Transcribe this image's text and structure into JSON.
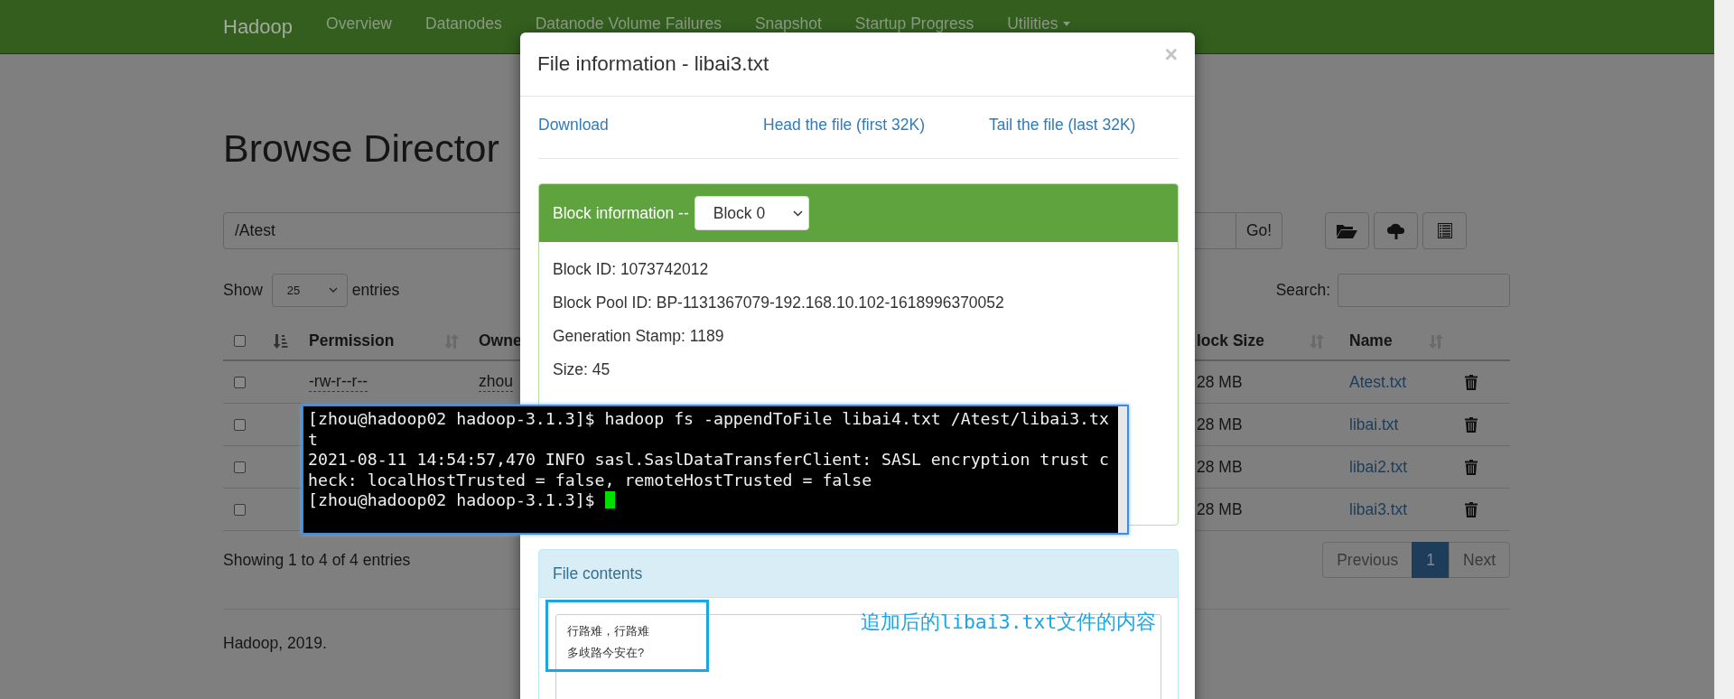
{
  "navbar": {
    "brand": "Hadoop",
    "items": [
      {
        "label": "Overview",
        "has_menu": false
      },
      {
        "label": "Datanodes",
        "has_menu": false
      },
      {
        "label": "Datanode Volume Failures",
        "has_menu": false
      },
      {
        "label": "Snapshot",
        "has_menu": false
      },
      {
        "label": "Startup Progress",
        "has_menu": false
      },
      {
        "label": "Utilities",
        "has_menu": true
      }
    ]
  },
  "page": {
    "heading": "Browse Director",
    "path": "/Atest",
    "go": "Go!",
    "show_label": "Show",
    "page_size": "25",
    "entries_label": "entries",
    "search_label": "Search:",
    "table": {
      "header_checked": false,
      "columns": [
        {
          "label": "Permission"
        },
        {
          "label": "Owne"
        },
        {
          "label": "lock Size"
        },
        {
          "label": "Name"
        }
      ],
      "rows": [
        {
          "checked": false,
          "permission": "-rw-r--r--",
          "owner": "zhou",
          "block_size": "28 MB",
          "name": "Atest.txt"
        },
        {
          "checked": false,
          "block_size": "28 MB",
          "name": "libai.txt"
        },
        {
          "checked": false,
          "block_size": "28 MB",
          "name": "libai2.txt"
        },
        {
          "checked": false,
          "block_size": "28 MB",
          "name": "libai3.txt"
        }
      ]
    },
    "info": "Showing 1 to 4 of 4 entries",
    "pagination": [
      {
        "label": "Previous",
        "selected": false
      },
      {
        "label": "1",
        "selected": true
      },
      {
        "label": "Next",
        "selected": false
      }
    ],
    "footer": "Hadoop, 2019."
  },
  "modal": {
    "title": "File information - libai3.txt",
    "close": "×",
    "links": [
      "Download",
      "Head the file (first 32K)",
      "Tail the file (last 32K)"
    ],
    "block_panel": {
      "heading": "Block information --",
      "block": "Block 0",
      "fields": [
        "Block ID: 1073742012",
        "Block Pool ID: BP-1131367079-192.168.10.102-1618996370052",
        "Generation Stamp: 1189",
        "Size: 45"
      ]
    },
    "contents_panel": {
      "heading": "File contents",
      "content_lines": [
        "行路难，行路难",
        "多歧路今安在?"
      ]
    }
  },
  "terminal": {
    "lines": [
      "[zhou@hadoop02 hadoop-3.1.3]$ hadoop fs -appendToFile libai4.txt /Atest/libai3.tx",
      "t",
      "2021-08-11 14:54:57,470 INFO sasl.SaslDataTransferClient: SASL encryption trust c",
      "heck: localHostTrusted = false, remoteHostTrusted = false"
    ],
    "prompt": "[zhou@hadoop02 hadoop-3.1.3]$"
  },
  "annotation": {
    "text": "追加后的libai3.txt文件的内容"
  }
}
